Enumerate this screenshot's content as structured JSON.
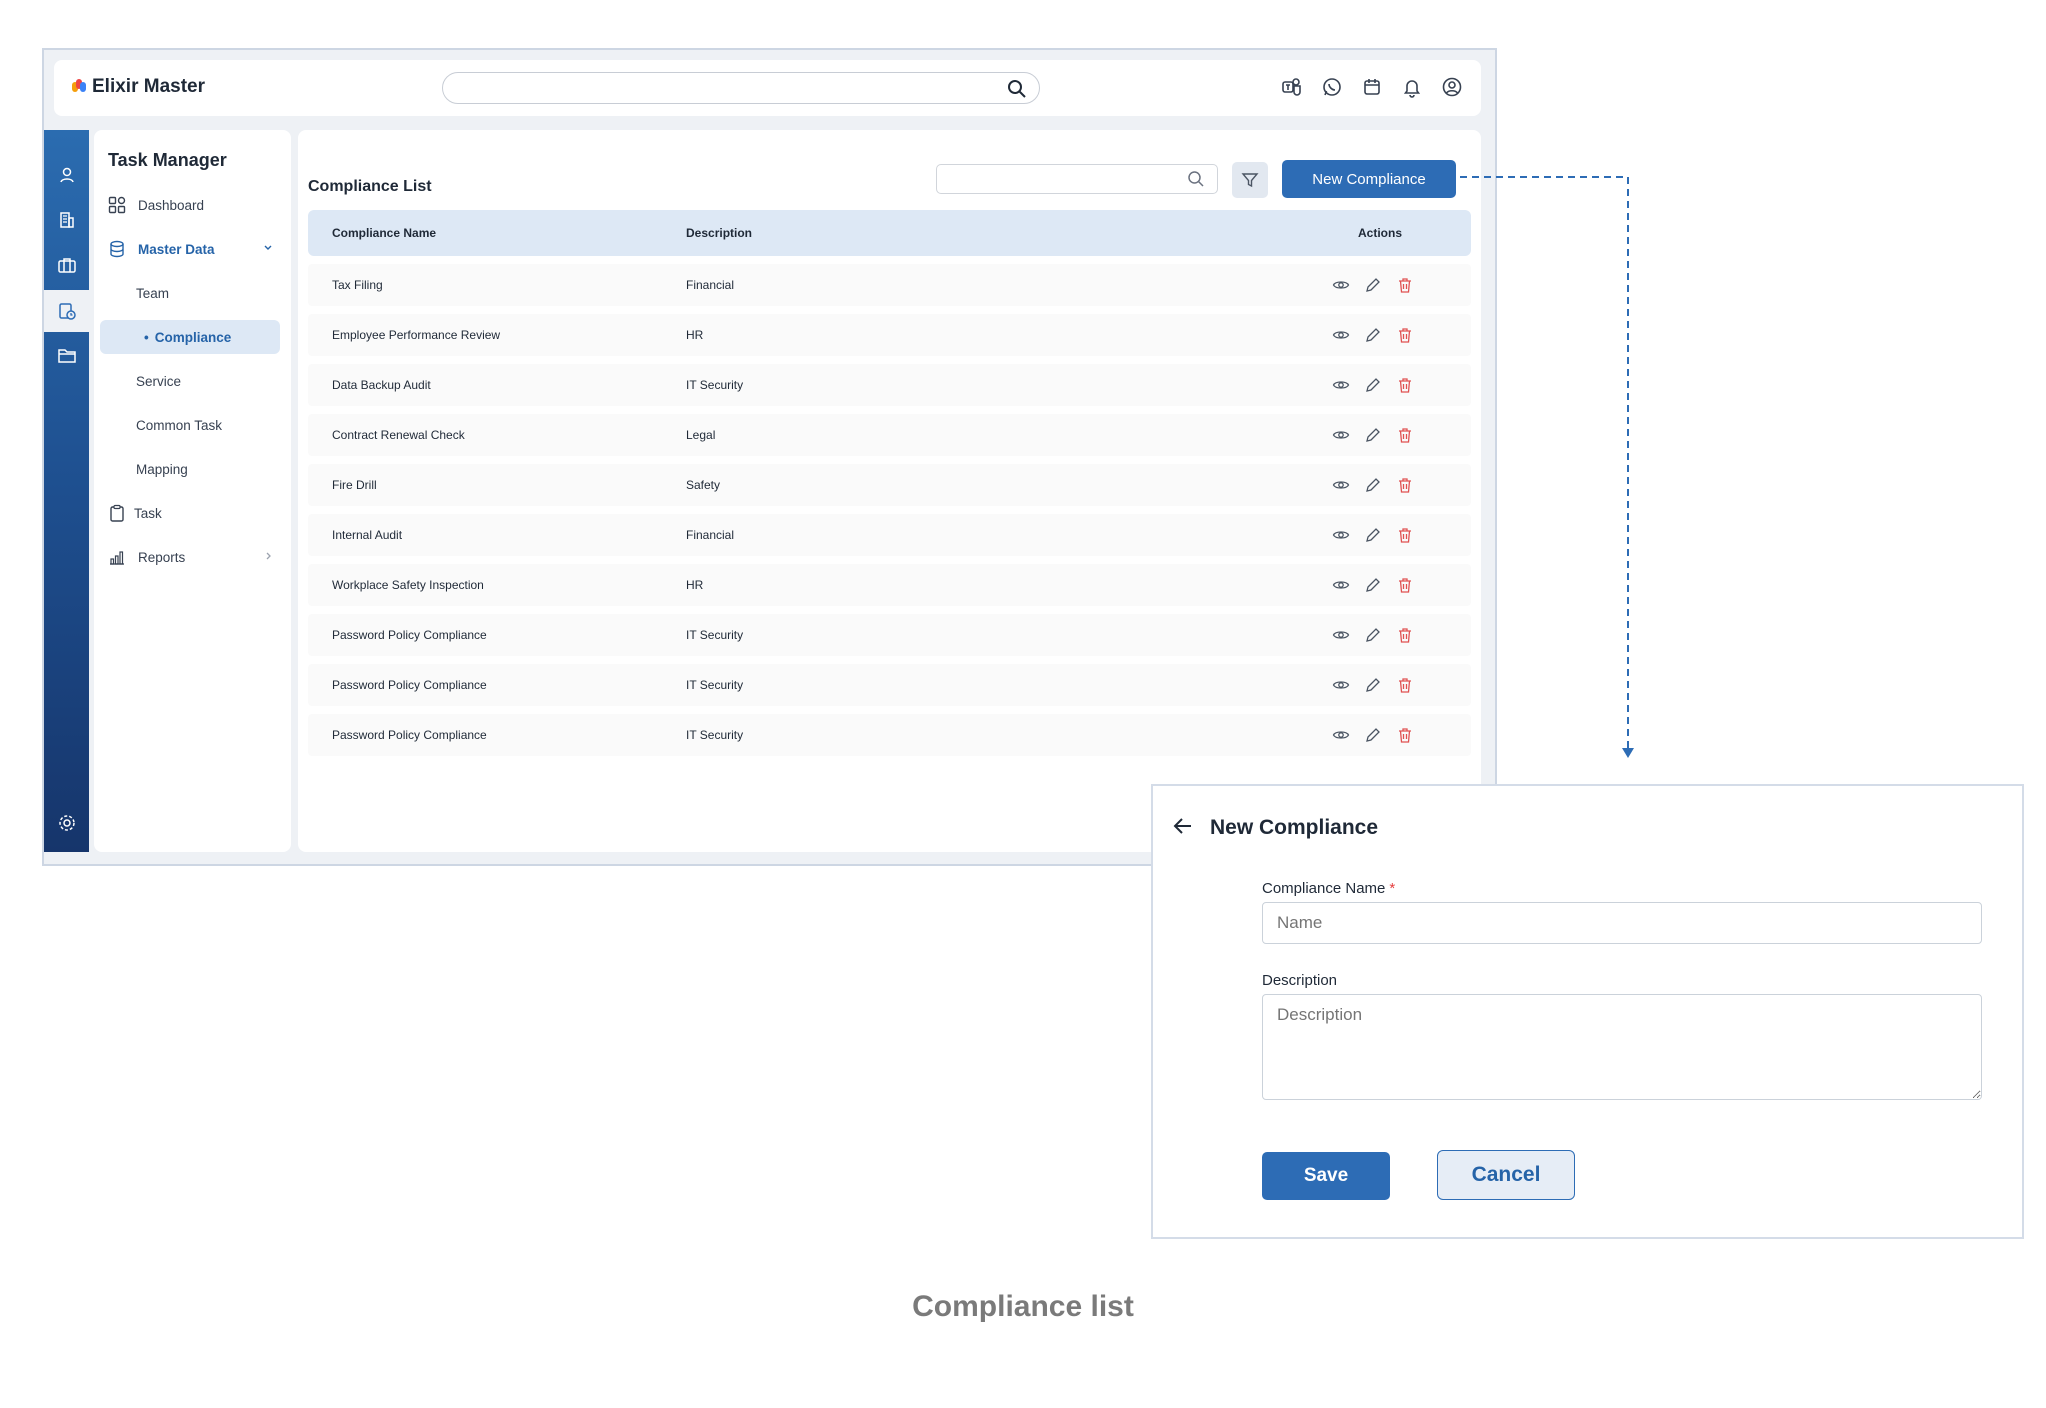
{
  "app": {
    "brand_name": "Elixir Master",
    "brand_colors": [
      "#f59e0b",
      "#ef4444",
      "#3b82f6"
    ]
  },
  "topbar": {
    "icons": [
      "teams-icon",
      "whatsapp-icon",
      "calendar-icon",
      "bell-icon",
      "user-circle-icon"
    ]
  },
  "rail": {
    "icons": [
      "user-icon",
      "building-icon",
      "briefcase-icon",
      "clipboard-clock-icon",
      "folder-icon",
      "settings-icon"
    ]
  },
  "sidebar": {
    "title": "Task Manager",
    "items": [
      {
        "label": "Dashboard",
        "icon": "dashboard-icon"
      },
      {
        "label": "Master Data",
        "icon": "database-icon"
      },
      {
        "label": "Team"
      },
      {
        "label": "Compliance"
      },
      {
        "label": "Service"
      },
      {
        "label": "Common Task"
      },
      {
        "label": "Mapping"
      },
      {
        "label": "Task",
        "icon": "clipboard-icon"
      },
      {
        "label": "Reports",
        "icon": "bar-chart-icon"
      }
    ]
  },
  "main": {
    "title": "Compliance List",
    "new_button": "New Compliance",
    "columns": [
      "Compliance Name",
      "Description",
      "Actions"
    ],
    "rows": [
      {
        "name": "Tax Filing",
        "description": "Financial"
      },
      {
        "name": "Employee Performance Review",
        "description": "HR"
      },
      {
        "name": "Data Backup Audit",
        "description": "IT Security"
      },
      {
        "name": "Contract Renewal Check",
        "description": "Legal"
      },
      {
        "name": "Fire Drill",
        "description": "Safety"
      },
      {
        "name": "Internal Audit",
        "description": "Financial"
      },
      {
        "name": "Workplace Safety Inspection",
        "description": "HR"
      },
      {
        "name": "Password Policy Compliance",
        "description": "IT Security"
      },
      {
        "name": "Password Policy Compliance",
        "description": "IT Security"
      },
      {
        "name": "Password Policy Compliance",
        "description": "IT Security"
      }
    ]
  },
  "panel": {
    "title": "New Compliance",
    "name_label": "Compliance Name",
    "required_mark": "*",
    "name_placeholder": "Name",
    "description_label": "Description",
    "description_placeholder": "Description",
    "save_label": "Save",
    "cancel_label": "Cancel"
  },
  "caption": "Compliance list",
  "colors": {
    "accent": "#2d6cb5",
    "delete": "#e05252",
    "rail_top": "#2b6cb0",
    "rail_bottom": "#16356b"
  }
}
